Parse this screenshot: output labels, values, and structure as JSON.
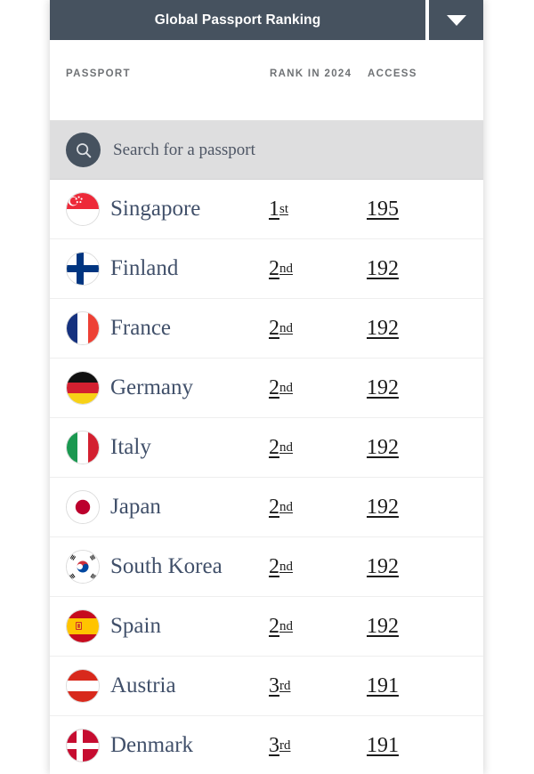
{
  "header": {
    "title": "Global Passport Ranking",
    "dropdown_icon": "chevron-down-icon"
  },
  "columns": {
    "passport": "PASSPORT",
    "rank": "RANK IN 2024",
    "access": "ACCESS"
  },
  "search": {
    "placeholder": "Search for a passport",
    "icon": "search-icon"
  },
  "colors": {
    "header_bg": "#46525f",
    "search_bg": "#dededf",
    "country_text": "#41506a",
    "value_text": "#1b1b1b",
    "column_label": "#6f7275"
  },
  "rows": [
    {
      "country": "Singapore",
      "flag": "flag-singapore",
      "rank_num": "1",
      "rank_suffix": "st",
      "access": "195"
    },
    {
      "country": "Finland",
      "flag": "flag-finland",
      "rank_num": "2",
      "rank_suffix": "nd",
      "access": "192"
    },
    {
      "country": "France",
      "flag": "flag-france",
      "rank_num": "2",
      "rank_suffix": "nd",
      "access": "192"
    },
    {
      "country": "Germany",
      "flag": "flag-germany",
      "rank_num": "2",
      "rank_suffix": "nd",
      "access": "192"
    },
    {
      "country": "Italy",
      "flag": "flag-italy",
      "rank_num": "2",
      "rank_suffix": "nd",
      "access": "192"
    },
    {
      "country": "Japan",
      "flag": "flag-japan",
      "rank_num": "2",
      "rank_suffix": "nd",
      "access": "192"
    },
    {
      "country": "South Korea",
      "flag": "flag-south-korea",
      "rank_num": "2",
      "rank_suffix": "nd",
      "access": "192"
    },
    {
      "country": "Spain",
      "flag": "flag-spain",
      "rank_num": "2",
      "rank_suffix": "nd",
      "access": "192"
    },
    {
      "country": "Austria",
      "flag": "flag-austria",
      "rank_num": "3",
      "rank_suffix": "rd",
      "access": "191"
    },
    {
      "country": "Denmark",
      "flag": "flag-denmark",
      "rank_num": "3",
      "rank_suffix": "rd",
      "access": "191"
    }
  ]
}
